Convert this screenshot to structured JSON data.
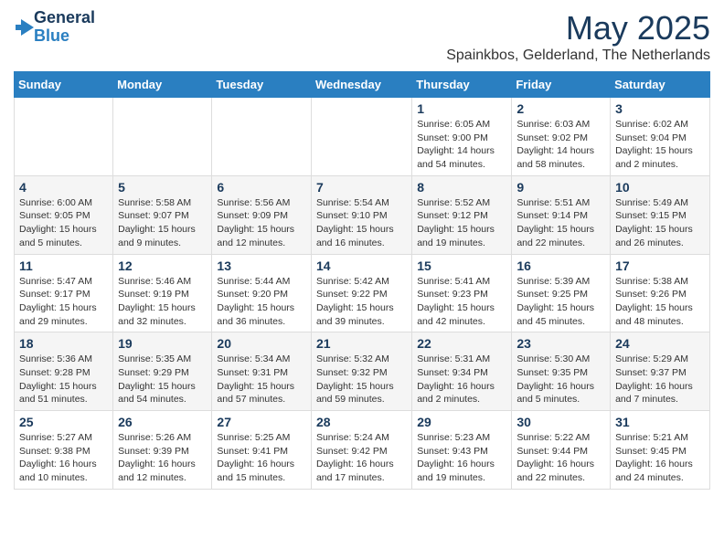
{
  "header": {
    "logo_line1": "General",
    "logo_line2": "Blue",
    "month": "May 2025",
    "location": "Spainkbos, Gelderland, The Netherlands"
  },
  "days_of_week": [
    "Sunday",
    "Monday",
    "Tuesday",
    "Wednesday",
    "Thursday",
    "Friday",
    "Saturday"
  ],
  "weeks": [
    [
      {
        "day": "",
        "detail": ""
      },
      {
        "day": "",
        "detail": ""
      },
      {
        "day": "",
        "detail": ""
      },
      {
        "day": "",
        "detail": ""
      },
      {
        "day": "1",
        "detail": "Sunrise: 6:05 AM\nSunset: 9:00 PM\nDaylight: 14 hours\nand 54 minutes."
      },
      {
        "day": "2",
        "detail": "Sunrise: 6:03 AM\nSunset: 9:02 PM\nDaylight: 14 hours\nand 58 minutes."
      },
      {
        "day": "3",
        "detail": "Sunrise: 6:02 AM\nSunset: 9:04 PM\nDaylight: 15 hours\nand 2 minutes."
      }
    ],
    [
      {
        "day": "4",
        "detail": "Sunrise: 6:00 AM\nSunset: 9:05 PM\nDaylight: 15 hours\nand 5 minutes."
      },
      {
        "day": "5",
        "detail": "Sunrise: 5:58 AM\nSunset: 9:07 PM\nDaylight: 15 hours\nand 9 minutes."
      },
      {
        "day": "6",
        "detail": "Sunrise: 5:56 AM\nSunset: 9:09 PM\nDaylight: 15 hours\nand 12 minutes."
      },
      {
        "day": "7",
        "detail": "Sunrise: 5:54 AM\nSunset: 9:10 PM\nDaylight: 15 hours\nand 16 minutes."
      },
      {
        "day": "8",
        "detail": "Sunrise: 5:52 AM\nSunset: 9:12 PM\nDaylight: 15 hours\nand 19 minutes."
      },
      {
        "day": "9",
        "detail": "Sunrise: 5:51 AM\nSunset: 9:14 PM\nDaylight: 15 hours\nand 22 minutes."
      },
      {
        "day": "10",
        "detail": "Sunrise: 5:49 AM\nSunset: 9:15 PM\nDaylight: 15 hours\nand 26 minutes."
      }
    ],
    [
      {
        "day": "11",
        "detail": "Sunrise: 5:47 AM\nSunset: 9:17 PM\nDaylight: 15 hours\nand 29 minutes."
      },
      {
        "day": "12",
        "detail": "Sunrise: 5:46 AM\nSunset: 9:19 PM\nDaylight: 15 hours\nand 32 minutes."
      },
      {
        "day": "13",
        "detail": "Sunrise: 5:44 AM\nSunset: 9:20 PM\nDaylight: 15 hours\nand 36 minutes."
      },
      {
        "day": "14",
        "detail": "Sunrise: 5:42 AM\nSunset: 9:22 PM\nDaylight: 15 hours\nand 39 minutes."
      },
      {
        "day": "15",
        "detail": "Sunrise: 5:41 AM\nSunset: 9:23 PM\nDaylight: 15 hours\nand 42 minutes."
      },
      {
        "day": "16",
        "detail": "Sunrise: 5:39 AM\nSunset: 9:25 PM\nDaylight: 15 hours\nand 45 minutes."
      },
      {
        "day": "17",
        "detail": "Sunrise: 5:38 AM\nSunset: 9:26 PM\nDaylight: 15 hours\nand 48 minutes."
      }
    ],
    [
      {
        "day": "18",
        "detail": "Sunrise: 5:36 AM\nSunset: 9:28 PM\nDaylight: 15 hours\nand 51 minutes."
      },
      {
        "day": "19",
        "detail": "Sunrise: 5:35 AM\nSunset: 9:29 PM\nDaylight: 15 hours\nand 54 minutes."
      },
      {
        "day": "20",
        "detail": "Sunrise: 5:34 AM\nSunset: 9:31 PM\nDaylight: 15 hours\nand 57 minutes."
      },
      {
        "day": "21",
        "detail": "Sunrise: 5:32 AM\nSunset: 9:32 PM\nDaylight: 15 hours\nand 59 minutes."
      },
      {
        "day": "22",
        "detail": "Sunrise: 5:31 AM\nSunset: 9:34 PM\nDaylight: 16 hours\nand 2 minutes."
      },
      {
        "day": "23",
        "detail": "Sunrise: 5:30 AM\nSunset: 9:35 PM\nDaylight: 16 hours\nand 5 minutes."
      },
      {
        "day": "24",
        "detail": "Sunrise: 5:29 AM\nSunset: 9:37 PM\nDaylight: 16 hours\nand 7 minutes."
      }
    ],
    [
      {
        "day": "25",
        "detail": "Sunrise: 5:27 AM\nSunset: 9:38 PM\nDaylight: 16 hours\nand 10 minutes."
      },
      {
        "day": "26",
        "detail": "Sunrise: 5:26 AM\nSunset: 9:39 PM\nDaylight: 16 hours\nand 12 minutes."
      },
      {
        "day": "27",
        "detail": "Sunrise: 5:25 AM\nSunset: 9:41 PM\nDaylight: 16 hours\nand 15 minutes."
      },
      {
        "day": "28",
        "detail": "Sunrise: 5:24 AM\nSunset: 9:42 PM\nDaylight: 16 hours\nand 17 minutes."
      },
      {
        "day": "29",
        "detail": "Sunrise: 5:23 AM\nSunset: 9:43 PM\nDaylight: 16 hours\nand 19 minutes."
      },
      {
        "day": "30",
        "detail": "Sunrise: 5:22 AM\nSunset: 9:44 PM\nDaylight: 16 hours\nand 22 minutes."
      },
      {
        "day": "31",
        "detail": "Sunrise: 5:21 AM\nSunset: 9:45 PM\nDaylight: 16 hours\nand 24 minutes."
      }
    ]
  ]
}
